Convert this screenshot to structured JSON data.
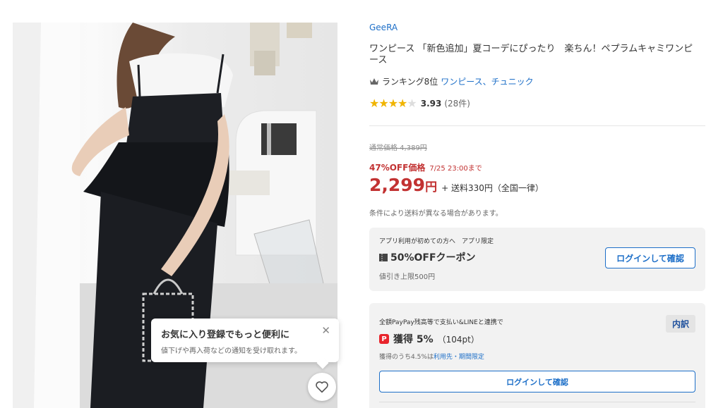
{
  "product": {
    "store": "GeeRA",
    "title": "ワンピース 「新色追加」夏コーデにぴったり　楽ちん！ペプラムキャミワンピース",
    "ranking_label": "ランキング8位",
    "ranking_category": "ワンピース、チュニック",
    "rating": 3.93,
    "rating_text": "3.93",
    "review_count": "(28件)"
  },
  "pricing": {
    "original": "通常価格 4,389円",
    "sale_label": "47%OFF価格",
    "sale_until": "7/25 23:00まで",
    "price": "2,299",
    "yen": "円",
    "shipping": "+ 送料330円（全国一律）",
    "shipping_note": "条件により送料が異なる場合があります。"
  },
  "coupon": {
    "tag": "アプリ利用が初めての方へ　アプリ限定",
    "name": "50%OFFクーポン",
    "limit": "値引き上限500円",
    "button": "ログインして確認"
  },
  "paypay": {
    "desc": "全額PayPay残高等で支払い&LINEと連携で",
    "earn": "獲得 5%",
    "points": "（104pt）",
    "note_prefix": "獲得のうち4.5%は",
    "note_link": "利用先・期間限定",
    "breakdown": "内訳",
    "button": "ログインして確認"
  },
  "favorite_tip": {
    "title": "お気に入り登録でもっと便利に",
    "body": "値下げや再入荷などの通知を受け取れます。"
  },
  "colors": {
    "link": "#1d6fc8",
    "sale": "#c23232",
    "star": "#f0b400",
    "paypay": "#e8242c"
  }
}
